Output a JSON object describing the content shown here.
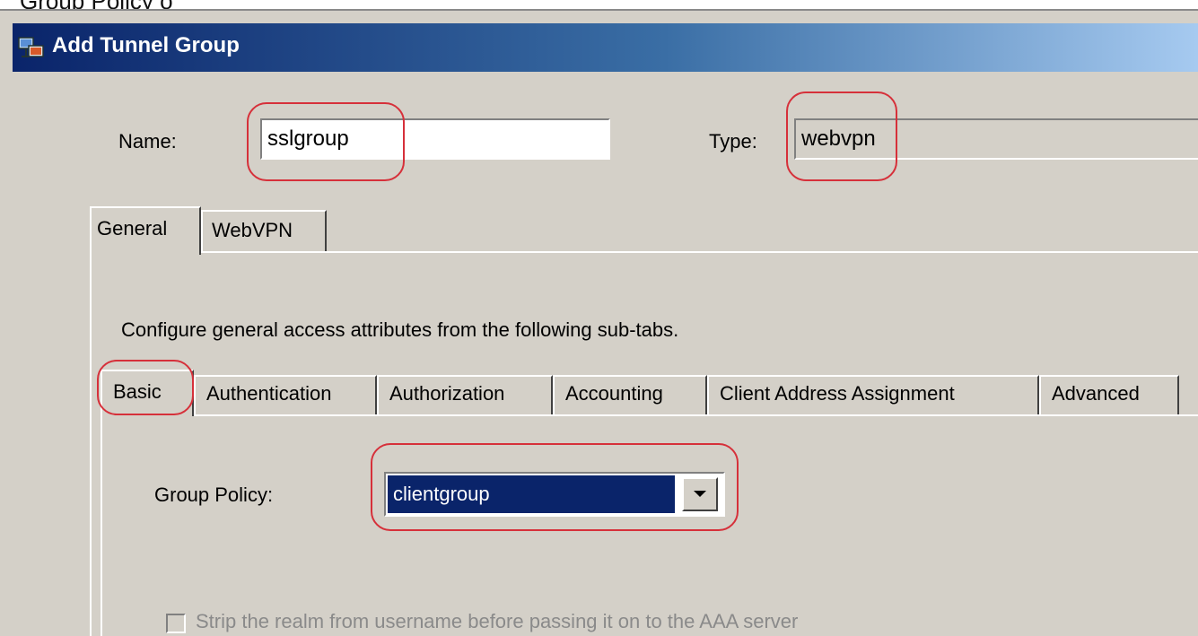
{
  "page": {
    "caption": "Group Policy o"
  },
  "dialog": {
    "title": "Add Tunnel Group",
    "title_icon": "network-icon",
    "name_label": "Name:",
    "name_value": "sslgroup",
    "type_label": "Type:",
    "type_value": "webvpn",
    "outer_tabs": [
      {
        "label": "General",
        "active": true
      },
      {
        "label": "WebVPN",
        "active": false
      }
    ],
    "description": "Configure general access attributes from the following sub-tabs.",
    "sub_tabs": [
      {
        "label": "Basic",
        "active": true
      },
      {
        "label": "Authentication",
        "active": false
      },
      {
        "label": "Authorization",
        "active": false
      },
      {
        "label": "Accounting",
        "active": false
      },
      {
        "label": "Client Address Assignment",
        "active": false
      },
      {
        "label": "Advanced",
        "active": false
      }
    ],
    "group_policy_label": "Group Policy:",
    "group_policy_value": "clientgroup",
    "strip_realm_label": "Strip the realm from username before passing it on to the AAA server",
    "strip_realm_checked": false
  },
  "colors": {
    "dialog_bg": "#d4d0c8",
    "title_bar_start": "#0a246a",
    "title_bar_end": "#a6caf0",
    "highlight_outline": "#d6303a",
    "selection_bg": "#0a246a"
  }
}
